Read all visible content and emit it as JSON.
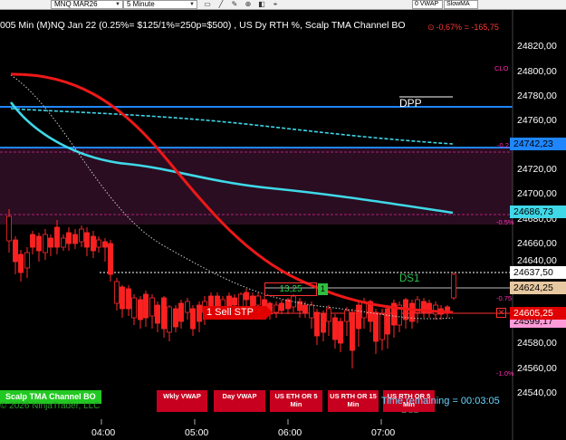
{
  "toolbar": {
    "instrument": "MNQ MAR26",
    "interval": "5 Minute",
    "vwap_label": "0 VWAP",
    "slowma_label": "SlowMA"
  },
  "chart": {
    "title": "005 Min (M)NQ Jan 22 (0.25%= $125/1%=250p=$500) , US Dy RTH %, Scalp TMA Channel BO",
    "pnl": "-0,67% = -165,75",
    "y_ticks": [
      "24820,00",
      "24800,00",
      "24780,00",
      "24760,00",
      "24720,00",
      "24700,00",
      "24680,00",
      "24660,00",
      "24640,00",
      "24580,00",
      "24560,00",
      "24540,00"
    ],
    "x_ticks": [
      "04:00",
      "05:00",
      "06:00",
      "07:00"
    ],
    "price_tags": {
      "dpp_level": "24742,23",
      "upper_band": "24686,73",
      "last": "24637,50",
      "current": "24624,25",
      "stop": "24605,25",
      "lower": "24599,17"
    },
    "pct_labels": [
      "CLO",
      "-0.2",
      "-0.5%",
      "-0.75",
      "-1.0%"
    ],
    "dpp": "DPP",
    "ds1": "DS1",
    "ds2": "DS2",
    "order_value": "13,25",
    "order_qty": "1",
    "sell_stop": "1 Sell STP",
    "close_x": "✕",
    "copyright": "© 2026 NinjaTrader, LLC",
    "time_remaining": "Time remaining = 00:03:05",
    "colors": {
      "bull": "#ff2020",
      "bear": "#ff2020",
      "ema": "#ff1a1a",
      "tma": "#3fd8e8",
      "band": "#1f86ff"
    }
  },
  "buttons": {
    "scalp_bo": "Scalp TMA Channel BO",
    "wkly_vwap": "Wkly VWAP",
    "day_vwap": "Day VWAP",
    "eth_5": "US ETH OR 5 Min",
    "rth_15": "US RTH OR 15 Min",
    "rth_5": "US RTH OR 5 Min"
  }
}
